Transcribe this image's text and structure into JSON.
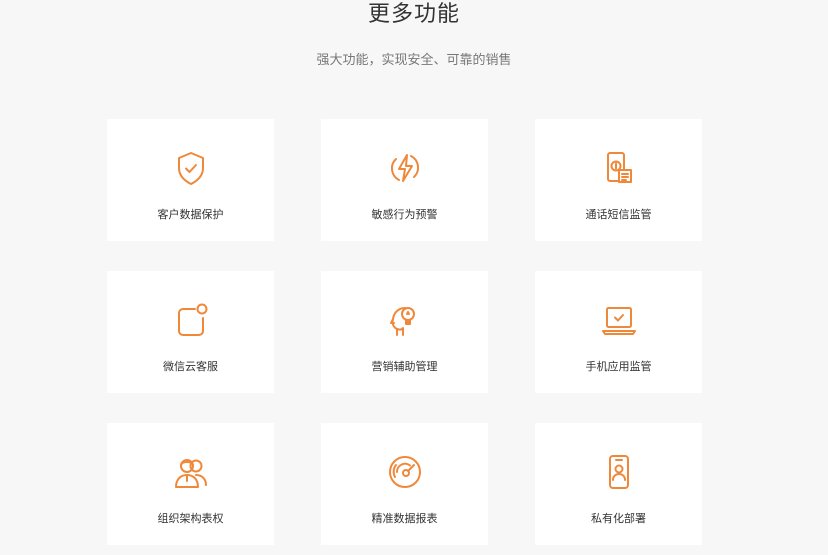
{
  "header": {
    "title": "更多功能",
    "subtitle": "强大功能，实现安全、可靠的销售"
  },
  "accent_color": "#f0883a",
  "features": [
    {
      "label": "客户数据保护",
      "icon": "shield-check-icon"
    },
    {
      "label": "敏感行为预警",
      "icon": "lightning-circle-icon"
    },
    {
      "label": "通话短信监管",
      "icon": "phone-document-icon"
    },
    {
      "label": "微信云客服",
      "icon": "chat-notification-icon"
    },
    {
      "label": "营销辅助管理",
      "icon": "head-lightbulb-icon"
    },
    {
      "label": "手机应用监管",
      "icon": "laptop-check-icon"
    },
    {
      "label": "组织架构表权",
      "icon": "users-group-icon"
    },
    {
      "label": "精准数据报表",
      "icon": "gauge-icon"
    },
    {
      "label": "私有化部署",
      "icon": "mobile-person-icon"
    }
  ]
}
